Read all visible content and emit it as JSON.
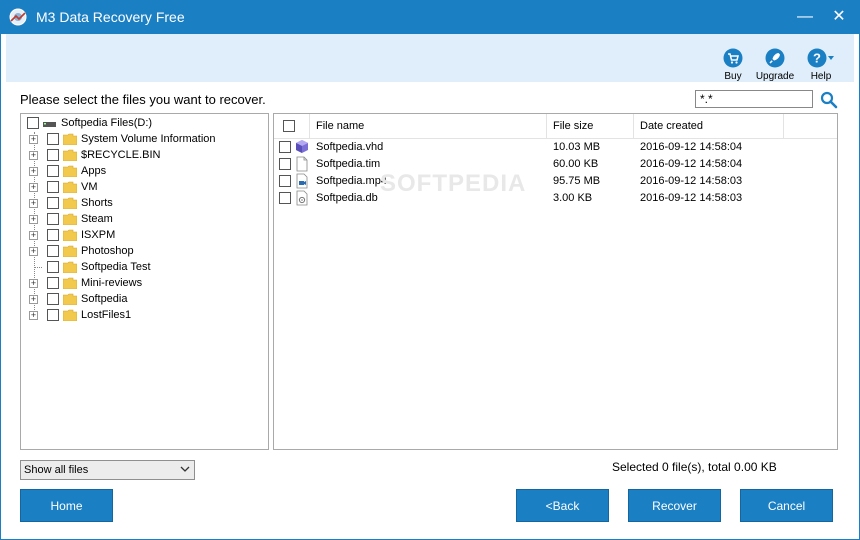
{
  "window": {
    "title": "M3 Data Recovery Free",
    "minimize_glyph": "—",
    "close_glyph": "✕"
  },
  "toolbar": {
    "buy_label": "Buy",
    "buy_icon": "cart-icon",
    "upgrade_label": "Upgrade",
    "upgrade_icon": "rocket-icon",
    "help_label": "Help",
    "help_icon": "help-icon"
  },
  "instruction": "Please select the files you want to recover.",
  "search": {
    "value": "*.*",
    "icon": "search-icon"
  },
  "tree": {
    "root_label": "Softpedia Files(D:)",
    "items": [
      {
        "label": "System Volume Information",
        "expandable": true
      },
      {
        "label": "$RECYCLE.BIN",
        "expandable": true
      },
      {
        "label": "Apps",
        "expandable": true
      },
      {
        "label": "VM",
        "expandable": true
      },
      {
        "label": "Shorts",
        "expandable": true
      },
      {
        "label": "Steam",
        "expandable": true
      },
      {
        "label": "ISXPM",
        "expandable": true
      },
      {
        "label": "Photoshop",
        "expandable": true
      },
      {
        "label": "Softpedia Test",
        "expandable": false
      },
      {
        "label": "Mini-reviews",
        "expandable": true
      },
      {
        "label": "Softpedia",
        "expandable": true
      },
      {
        "label": "LostFiles1",
        "expandable": true
      }
    ]
  },
  "files": {
    "columns": {
      "name": "File name",
      "size": "File size",
      "date": "Date created"
    },
    "rows": [
      {
        "name": "Softpedia.vhd",
        "size": "10.03 MB",
        "date": "2016-09-12 14:58:04",
        "icon": "vhd-file-icon"
      },
      {
        "name": "Softpedia.tim",
        "size": "60.00 KB",
        "date": "2016-09-12 14:58:04",
        "icon": "blank-file-icon"
      },
      {
        "name": "Softpedia.mp4",
        "size": "95.75 MB",
        "date": "2016-09-12 14:58:03",
        "icon": "video-file-icon"
      },
      {
        "name": "Softpedia.db",
        "size": "3.00 KB",
        "date": "2016-09-12 14:58:03",
        "icon": "db-file-icon"
      }
    ]
  },
  "watermark": "SOFTPEDIA",
  "filter": {
    "selected": "Show all files"
  },
  "status": "Selected 0 file(s), total 0.00 KB",
  "buttons": {
    "home": "Home",
    "back": "<Back",
    "recover": "Recover",
    "cancel": "Cancel"
  },
  "colors": {
    "accent": "#1b7fc4",
    "toolbar_bg": "#dfeefa",
    "folder": "#f2c94c"
  }
}
